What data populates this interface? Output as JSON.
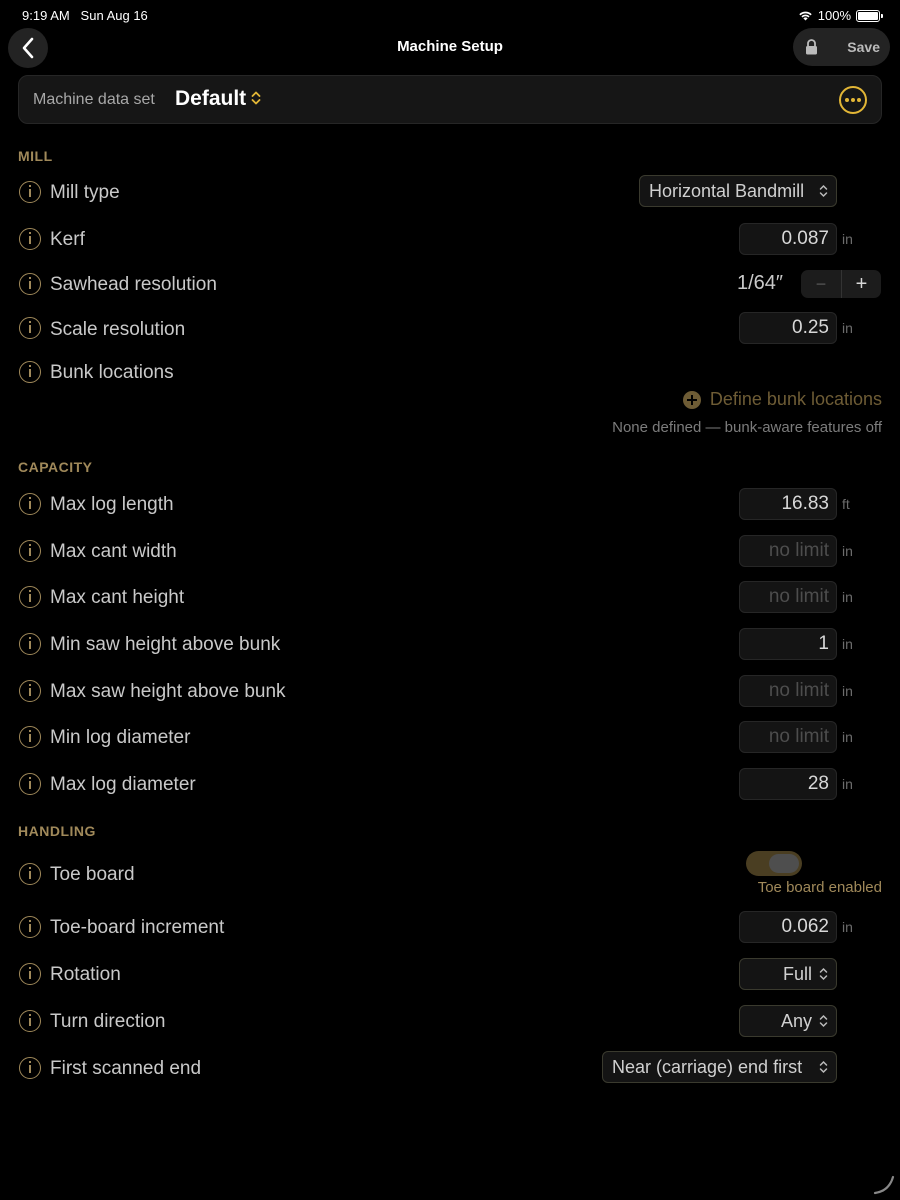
{
  "status": {
    "time": "9:19 AM",
    "date": "Sun Aug 16",
    "battery": "100%",
    "battery_level": 1.0
  },
  "nav": {
    "title": "Machine Setup",
    "save": "Save"
  },
  "dataset": {
    "label": "Machine data set",
    "value": "Default"
  },
  "mill": {
    "title": "MILL",
    "mill_type": {
      "label": "Mill type",
      "value": "Horizontal Bandmill"
    },
    "kerf": {
      "label": "Kerf",
      "value": "0.087",
      "unit": "in"
    },
    "sawhead": {
      "label": "Sawhead resolution",
      "value": "1/64″",
      "minus": "−",
      "plus": "+"
    },
    "scale": {
      "label": "Scale resolution",
      "value": "0.25",
      "unit": "in"
    },
    "bunk": {
      "label": "Bunk locations",
      "action": "Define bunk locations",
      "note": "None defined — bunk-aware features off"
    }
  },
  "capacity": {
    "title": "CAPACITY",
    "max_log_length": {
      "label": "Max log length",
      "value": "16.83",
      "unit": "ft"
    },
    "max_cant_width": {
      "label": "Max cant width",
      "value": "no limit",
      "unit": "in"
    },
    "max_cant_height": {
      "label": "Max cant height",
      "value": "no limit",
      "unit": "in"
    },
    "min_saw_height": {
      "label": "Min saw height above bunk",
      "value": "1",
      "unit": "in"
    },
    "max_saw_height": {
      "label": "Max saw height above bunk",
      "value": "no limit",
      "unit": "in"
    },
    "min_log_diameter": {
      "label": "Min log diameter",
      "value": "no limit",
      "unit": "in"
    },
    "max_log_diameter": {
      "label": "Max log diameter",
      "value": "28",
      "unit": "in"
    }
  },
  "handling": {
    "title": "HANDLING",
    "toe_board": {
      "label": "Toe board",
      "note": "Toe board enabled",
      "enabled": true
    },
    "toe_increment": {
      "label": "Toe-board increment",
      "value": "0.062",
      "unit": "in"
    },
    "rotation": {
      "label": "Rotation",
      "value": "Full"
    },
    "turn_direction": {
      "label": "Turn direction",
      "value": "Any"
    },
    "first_scanned_end": {
      "label": "First scanned end",
      "value": "Near (carriage) end first"
    }
  },
  "colors": {
    "accent": "#e2b636",
    "section": "#a0895a",
    "background": "#000000"
  }
}
